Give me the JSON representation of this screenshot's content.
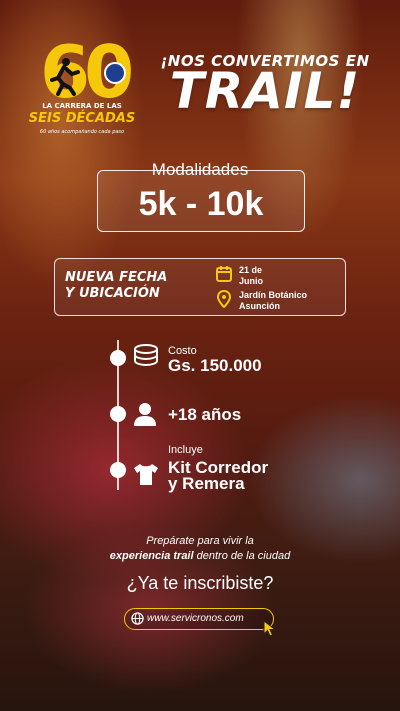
{
  "logo": {
    "number": "60",
    "line1": "LA CARRERA DE LAS",
    "line2": "SEIS DÉCADAS",
    "tagline": "60 años acompañando cada paso"
  },
  "headline": {
    "top": "¡NOS CONVERTIMOS EN",
    "main": "TRAIL!"
  },
  "modalities": {
    "label": "Modalidades",
    "value": "5k - 10k"
  },
  "new_info": {
    "title_line1": "NUEVA FECHA",
    "title_line2": "Y UBICACIÓN",
    "date_line1": "21 de",
    "date_line2": "Junio",
    "place_line1": "Jardín Botánico",
    "place_line2": "Asunción"
  },
  "details": {
    "cost_label": "Costo",
    "cost_value": "Gs. 150.000",
    "age_value": "+18 años",
    "includes_label": "Incluye",
    "includes_line1": "Kit Corredor",
    "includes_line2": "y Remera"
  },
  "footer": {
    "prepare_line1": "Prepárate para vivir la",
    "prepare_bold": "experiencia trail",
    "prepare_rest": " dentro de la ciudad",
    "question": "¿Ya te inscribiste?",
    "url": "www.servicronos.com"
  },
  "colors": {
    "accent": "#f6c80b",
    "text": "#ffffff"
  },
  "icons": [
    "runner-icon",
    "calendar-icon",
    "location-pin-icon",
    "coins-icon",
    "person-icon",
    "tshirt-icon",
    "globe-icon",
    "cursor-icon"
  ]
}
